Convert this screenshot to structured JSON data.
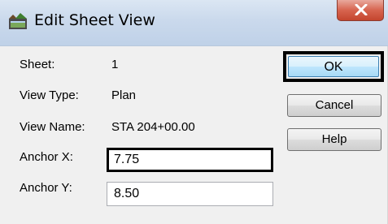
{
  "window": {
    "title": "Edit Sheet View",
    "app_icon": "sheet-view-icon",
    "close_icon": "close-icon",
    "close_color": "#c4452e"
  },
  "fields": {
    "sheet_label": "Sheet:",
    "sheet_value": "1",
    "view_type_label": "View Type:",
    "view_type_value": "Plan",
    "view_name_label": "View Name:",
    "view_name_value": "STA 204+00.00",
    "anchor_x_label": "Anchor X:",
    "anchor_x_value": "7.75",
    "anchor_y_label": "Anchor Y:",
    "anchor_y_value": "8.50"
  },
  "buttons": {
    "ok": "OK",
    "cancel": "Cancel",
    "help": "Help"
  }
}
